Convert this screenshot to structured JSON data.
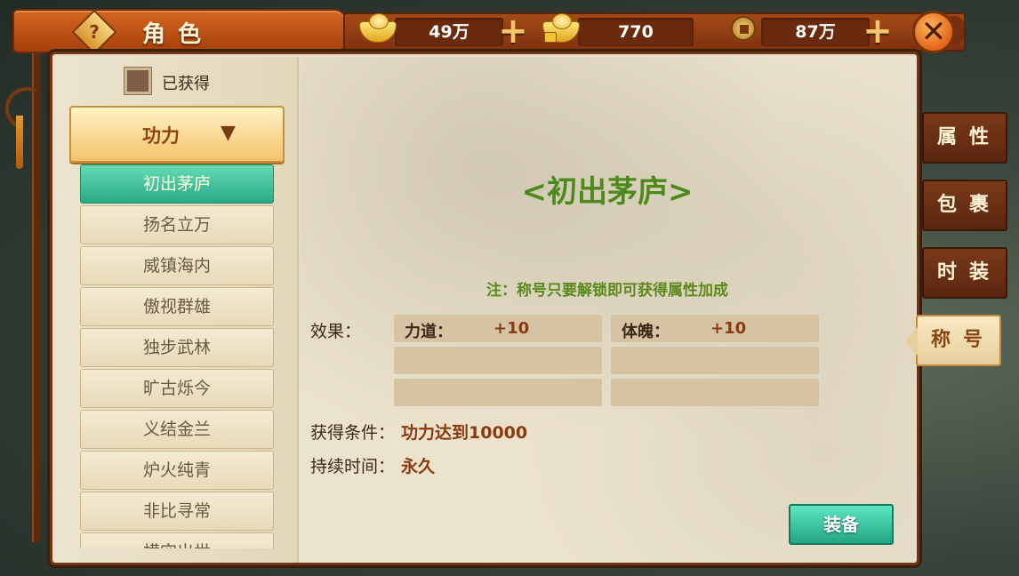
{
  "header": {
    "help_icon": "?",
    "title": "角色",
    "currencies": [
      {
        "icon": "gold-ingot-icon",
        "value": "49万",
        "has_plus": true
      },
      {
        "icon": "locked-gold-ingot-icon",
        "value": "770",
        "has_plus": false
      },
      {
        "icon": "copper-coin-icon",
        "value": "87万",
        "has_plus": true
      }
    ],
    "plus_symbol": "+",
    "close_symbol": "✕"
  },
  "filter": {
    "obtained_label": "已获得",
    "obtained_checked": false,
    "category": "功力",
    "arrow": "▼"
  },
  "title_list": [
    {
      "label": "初出茅庐",
      "active": true
    },
    {
      "label": "扬名立万",
      "active": false
    },
    {
      "label": "威镇海内",
      "active": false
    },
    {
      "label": "傲视群雄",
      "active": false
    },
    {
      "label": "独步武林",
      "active": false
    },
    {
      "label": "旷古烁今",
      "active": false
    },
    {
      "label": "义结金兰",
      "active": false
    },
    {
      "label": "炉火纯青",
      "active": false
    },
    {
      "label": "非比寻常",
      "active": false
    },
    {
      "label": "横空出世",
      "active": false
    }
  ],
  "detail": {
    "title": "<初出茅庐>",
    "note": "注：称号只要解锁即可获得属性加成",
    "effect_label": "效果：",
    "effects": [
      {
        "name": "力道：",
        "value": "+10"
      },
      {
        "name": "体魄：",
        "value": "+10"
      },
      {
        "name": "",
        "value": ""
      },
      {
        "name": "",
        "value": ""
      },
      {
        "name": "",
        "value": ""
      },
      {
        "name": "",
        "value": ""
      }
    ],
    "condition_label": "获得条件：",
    "condition_value": "功力达到10000",
    "duration_label": "持续时间：",
    "duration_value": "永久",
    "equip_button": "装备"
  },
  "side_tabs": [
    {
      "label": "属性",
      "active": false
    },
    {
      "label": "包裹",
      "active": false
    },
    {
      "label": "时装",
      "active": false
    },
    {
      "label": "称号",
      "active": true
    }
  ],
  "colors": {
    "accent_green": "#29a985",
    "title_green": "#4d8a1c",
    "value_red": "#8b3a10",
    "frame_brown": "#6a3815"
  }
}
